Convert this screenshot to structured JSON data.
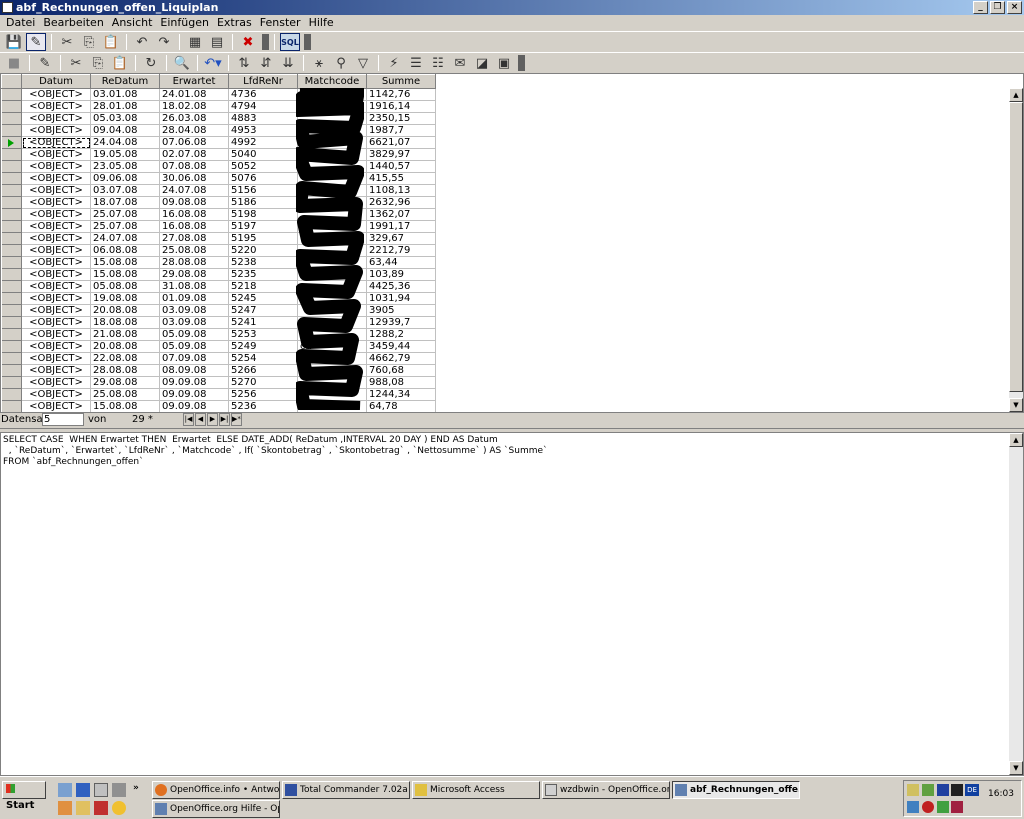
{
  "window": {
    "title": "abf_Rechnungen_offen_Liquiplan"
  },
  "menu": [
    "Datei",
    "Bearbeiten",
    "Ansicht",
    "Einfügen",
    "Extras",
    "Fenster",
    "Hilfe"
  ],
  "toolbar1": {
    "icons": [
      "save-icon",
      "edit-icon",
      "cut-icon",
      "copy-icon",
      "paste-icon",
      "undo-icon",
      "redo-icon",
      "form-icon",
      "report-icon",
      "delete-icon",
      "sql-icon"
    ],
    "sql_label": "SQL"
  },
  "toolbar2": {
    "icons": [
      "save-record-icon",
      "edit-data-icon",
      "cut-icon",
      "copy-icon",
      "paste-icon",
      "refresh-icon",
      "find-icon",
      "undo-icon",
      "sort-asc-icon",
      "sort-desc-icon",
      "sort-icon",
      "autofilter-icon",
      "standard-filter-icon",
      "remove-filter-icon",
      "apply-filter-icon",
      "data-to-text-icon",
      "data-to-fields-icon",
      "mail-merge-icon",
      "datasource-icon",
      "explorer-icon"
    ]
  },
  "grid": {
    "columns": [
      "Datum",
      "ReDatum",
      "Erwartet",
      "LfdReNr",
      "Matchcode",
      "Summe"
    ],
    "rows": [
      [
        "<OBJECT>",
        "03.01.08",
        "24.01.08",
        "4736",
        "",
        "1142,76"
      ],
      [
        "<OBJECT>",
        "28.01.08",
        "18.02.08",
        "4794",
        "",
        "1916,14"
      ],
      [
        "<OBJECT>",
        "05.03.08",
        "26.03.08",
        "4883",
        "",
        "2350,15"
      ],
      [
        "<OBJECT>",
        "09.04.08",
        "28.04.08",
        "4953",
        "",
        "1987,7"
      ],
      [
        "<OBJECT>",
        "24.04.08",
        "07.06.08",
        "4992",
        "",
        "6621,07"
      ],
      [
        "<OBJECT>",
        "19.05.08",
        "02.07.08",
        "5040",
        "",
        "3829,97"
      ],
      [
        "<OBJECT>",
        "23.05.08",
        "07.08.08",
        "5052",
        "5",
        "1440,57"
      ],
      [
        "<OBJECT>",
        "09.06.08",
        "30.06.08",
        "5076",
        "",
        "415,55"
      ],
      [
        "<OBJECT>",
        "03.07.08",
        "24.07.08",
        "5156",
        "",
        "1108,13"
      ],
      [
        "<OBJECT>",
        "18.07.08",
        "09.08.08",
        "5186",
        "",
        "2632,96"
      ],
      [
        "<OBJECT>",
        "25.07.08",
        "16.08.08",
        "5198",
        "",
        "1362,07"
      ],
      [
        "<OBJECT>",
        "25.07.08",
        "16.08.08",
        "5197",
        "",
        "1991,17"
      ],
      [
        "<OBJECT>",
        "24.07.08",
        "27.08.08",
        "5195",
        "",
        "329,67"
      ],
      [
        "<OBJECT>",
        "06.08.08",
        "25.08.08",
        "5220",
        "",
        "2212,79"
      ],
      [
        "<OBJECT>",
        "15.08.08",
        "28.08.08",
        "5238",
        "",
        "63,44"
      ],
      [
        "<OBJECT>",
        "15.08.08",
        "29.08.08",
        "5235",
        "n",
        "103,89"
      ],
      [
        "<OBJECT>",
        "05.08.08",
        "31.08.08",
        "5218",
        "",
        "4425,36"
      ],
      [
        "<OBJECT>",
        "19.08.08",
        "01.09.08",
        "5245",
        "",
        "1031,94"
      ],
      [
        "<OBJECT>",
        "20.08.08",
        "03.09.08",
        "5247",
        "",
        "3905"
      ],
      [
        "<OBJECT>",
        "18.08.08",
        "03.09.08",
        "5241",
        "h",
        "12939,7"
      ],
      [
        "<OBJECT>",
        "21.08.08",
        "05.09.08",
        "5253",
        "",
        "1288,2"
      ],
      [
        "<OBJECT>",
        "20.08.08",
        "05.09.08",
        "5249",
        "ch",
        "3459,44"
      ],
      [
        "<OBJECT>",
        "22.08.08",
        "07.09.08",
        "5254",
        "",
        "4662,79"
      ],
      [
        "<OBJECT>",
        "28.08.08",
        "08.09.08",
        "5266",
        "",
        "760,68"
      ],
      [
        "<OBJECT>",
        "29.08.08",
        "09.09.08",
        "5270",
        "",
        "988,08"
      ],
      [
        "<OBJECT>",
        "25.08.08",
        "09.09.08",
        "5256",
        "",
        "1244,34"
      ],
      [
        "<OBJECT>",
        "15.08.08",
        "09.09.08",
        "5236",
        "",
        "64,78"
      ]
    ],
    "current_row_index": 4
  },
  "navigator": {
    "label": "Datensatz",
    "record": "5",
    "of_label": "von",
    "count": "29 *",
    "buttons": [
      "first-icon",
      "prev-icon",
      "next-icon",
      "last-icon",
      "new-icon"
    ]
  },
  "sql": {
    "line1": "SELECT CASE  WHEN Erwartet THEN  Erwartet  ELSE DATE_ADD( ReDatum ,INTERVAL 20 DAY ) END AS Datum",
    "line2": "  , `ReDatum`, `Erwartet`, `LfdReNr` , `Matchcode` , If( `Skontobetrag` , `Skontobetrag` , `Nettosumme` ) AS `Summe`",
    "line3": "FROM `abf_Rechnungen_offen`"
  },
  "taskbar": {
    "start_label": "Start",
    "tasks": [
      {
        "label": "OpenOffice.info • Antwor...",
        "icon": "firefox-icon"
      },
      {
        "label": "Total Commander 7.02a -...",
        "icon": "total-commander-icon"
      },
      {
        "label": "Microsoft Access",
        "icon": "access-icon"
      },
      {
        "label": "wzdbwin - OpenOffice.or...",
        "icon": "openoffice-icon"
      },
      {
        "label": "abf_Rechnungen_offe...",
        "icon": "openoffice-base-icon"
      },
      {
        "label": "OpenOffice.org Hilfe - Op...",
        "icon": "openoffice-help-icon"
      }
    ],
    "active_task": 4,
    "language": "DE",
    "clock": "16:03"
  }
}
